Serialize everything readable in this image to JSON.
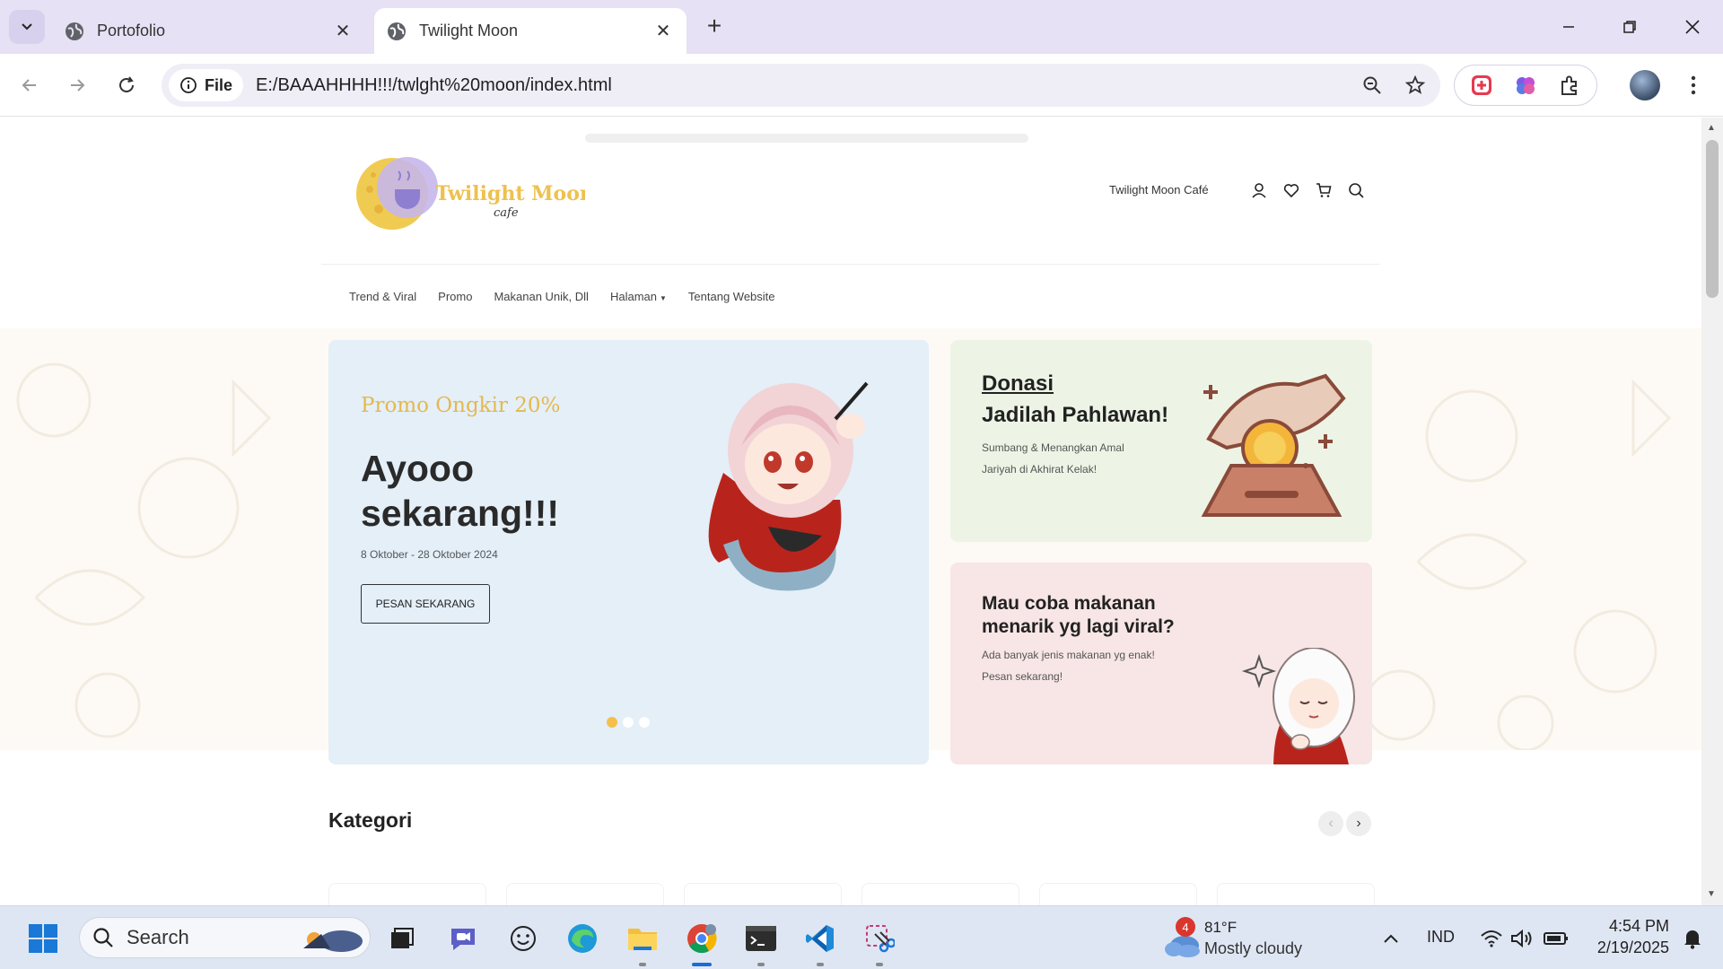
{
  "browser": {
    "tabs": [
      {
        "title": "Portofolio",
        "active": false
      },
      {
        "title": "Twilight Moon",
        "active": true
      }
    ],
    "omnibox": {
      "chip_label": "File",
      "url": "E:/BAAAHHHH!!!/twlght%20moon/index.html"
    }
  },
  "site": {
    "logo_text": "Twilight Moon",
    "logo_subtext": "cafe",
    "cafe_name": "Twilight Moon Café",
    "nav": [
      {
        "label": "Trend & Viral"
      },
      {
        "label": "Promo"
      },
      {
        "label": "Makanan Unik, Dll"
      },
      {
        "label": "Halaman"
      },
      {
        "label": "Tentang Website"
      }
    ],
    "hero": {
      "tag": "Promo Ongkir 20%",
      "title": "Ayooo sekarang!!!",
      "date": "8 Oktober - 28 Oktober 2024",
      "button": "PESAN SEKARANG",
      "slides": 3,
      "active_slide": 1
    },
    "donasi_card": {
      "link": "Donasi",
      "heading": "Jadilah Pahlawan!",
      "text": "Sumbang & Menangkan Amal Jariyah di Akhirat Kelak!"
    },
    "viral_card": {
      "heading": "Mau coba makanan menarik yg lagi viral?",
      "text": "Ada banyak jenis makanan yg enak! Pesan sekarang!"
    },
    "kategori": {
      "title": "Kategori",
      "prev": "‹",
      "next": "›"
    }
  },
  "taskbar": {
    "search_placeholder": "Search",
    "weather": {
      "temp": "81°F",
      "desc": "Mostly cloudy",
      "badge": "4"
    },
    "lang": "IND",
    "time": "4:54 PM",
    "date": "2/19/2025"
  },
  "colors": {
    "accent": "#f3c04b",
    "tabstrip": "#e6e1f4",
    "hero_card": "#e4eff8",
    "donasi_card": "#edf4e6",
    "viral_card": "#f7e6e5"
  }
}
